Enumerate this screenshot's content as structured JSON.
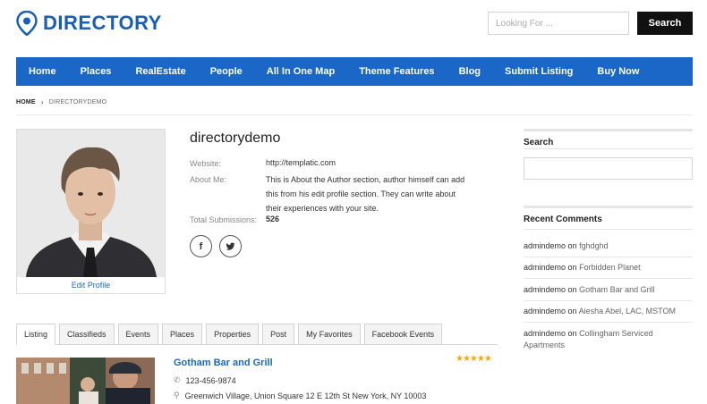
{
  "header": {
    "logo_text": "DIRECTORY",
    "search_placeholder": "Looking For ...",
    "search_button": "Search"
  },
  "nav": [
    "Home",
    "Places",
    "RealEstate",
    "People",
    "All In One Map",
    "Theme Features",
    "Blog",
    "Submit Listing",
    "Buy Now"
  ],
  "breadcrumb": {
    "home": "HOME",
    "current": "DIRECTORYDEMO"
  },
  "author": {
    "name": "directorydemo",
    "edit_profile": "Edit Profile",
    "website_label": "Website:",
    "website_value": "http://templatic.com",
    "about_label": "About Me:",
    "about_lines": [
      "This is About the Author section, author himself can add",
      "this from his edit profile section. They can write about",
      "their experiences with your site."
    ],
    "submissions_label": "Total Submissions:",
    "submissions_value": "526"
  },
  "tabs": [
    "Listing",
    "Classifieds",
    "Events",
    "Places",
    "Properties",
    "Post",
    "My Favorites",
    "Facebook Events"
  ],
  "listing": {
    "title": "Gotham Bar and Grill",
    "stars": "★★★★★",
    "phone": "123-456-9874",
    "address": "Greenwich Village, Union Square 12 E 12th St New York, NY 10003"
  },
  "sidebar": {
    "search_title": "Search",
    "recent_title": "Recent Comments",
    "on_word": "on",
    "comments": [
      {
        "author": "admindemo",
        "target": "fghdghd"
      },
      {
        "author": "admindemo",
        "target": "Forbidden Planet"
      },
      {
        "author": "admindemo",
        "target": "Gotham Bar and Grill"
      },
      {
        "author": "admindemo",
        "target": "Aiesha Abel, LAC, MSTOM"
      },
      {
        "author": "admindemo",
        "target": "Collingham Serviced Apartments"
      }
    ]
  },
  "colors": {
    "brand_blue": "#1a67c8",
    "logo_blue": "#1a5fb4",
    "star": "#f3a712"
  },
  "icons": {
    "logo": "map-pin-icon",
    "phone": "phone-icon",
    "address": "location-icon",
    "facebook": "facebook-icon",
    "twitter": "twitter-icon"
  }
}
